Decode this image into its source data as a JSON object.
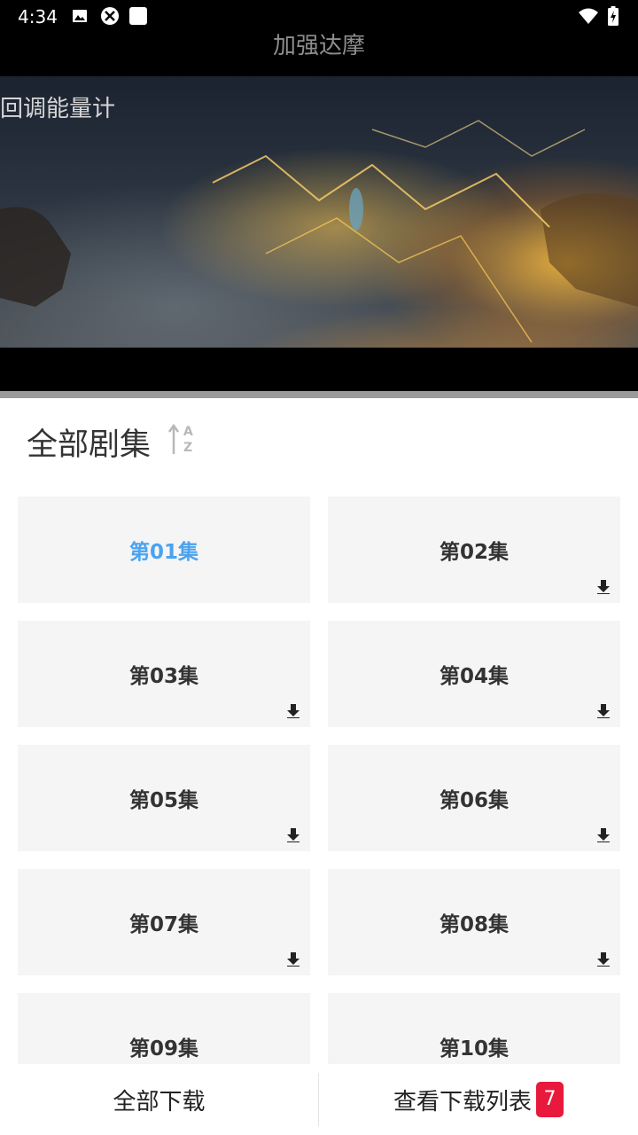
{
  "status_bar": {
    "time": "4:34",
    "left_icons": [
      "image-icon",
      "sync-icon",
      "square-icon"
    ],
    "right_icons": [
      "wifi-icon",
      "battery-charging-icon"
    ]
  },
  "header": {
    "title": "加强达摩"
  },
  "video": {
    "overlay_text": "回调能量计"
  },
  "episodes_panel": {
    "title": "全部剧集",
    "sort_icon": "sort-az-icon",
    "active_color": "#4aa3f0",
    "episodes": [
      {
        "label": "第01集",
        "downloadable": false,
        "active": true
      },
      {
        "label": "第02集",
        "downloadable": true
      },
      {
        "label": "第03集",
        "downloadable": true
      },
      {
        "label": "第04集",
        "downloadable": true
      },
      {
        "label": "第05集",
        "downloadable": true
      },
      {
        "label": "第06集",
        "downloadable": true
      },
      {
        "label": "第07集",
        "downloadable": true
      },
      {
        "label": "第08集",
        "downloadable": true
      },
      {
        "label": "第09集",
        "downloadable": true
      },
      {
        "label": "第10集",
        "downloadable": true
      }
    ]
  },
  "bottom_bar": {
    "download_all": "全部下载",
    "view_downloads": "查看下载列表",
    "badge_count": "7",
    "badge_color": "#e8193c"
  }
}
